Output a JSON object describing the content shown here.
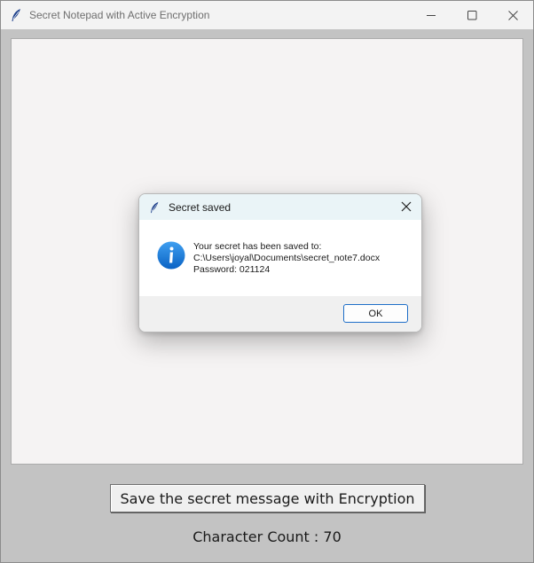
{
  "window": {
    "title": "Secret Notepad with Active Encryption",
    "icon": "feather-icon",
    "controls": [
      "minimize-icon",
      "maximize-icon",
      "close-icon"
    ]
  },
  "editor": {
    "content": ""
  },
  "main": {
    "save_button_label": "Save the secret message with Encryption",
    "char_count_label": "Character Count : ",
    "char_count_value": "70"
  },
  "dialog": {
    "title": "Secret saved",
    "icon": "info-icon",
    "message_line1": "Your secret has been saved to:",
    "message_line2": "C:\\Users\\joyal\\Documents\\secret_note7.docx",
    "message_line3": "Password: 021124",
    "ok_label": "OK"
  },
  "colors": {
    "client_background": "#c3c3c3",
    "editor_background": "#f5f3f3",
    "dialog_title_background": "#eaf4f7",
    "accent_blue": "#1e6ec8"
  }
}
